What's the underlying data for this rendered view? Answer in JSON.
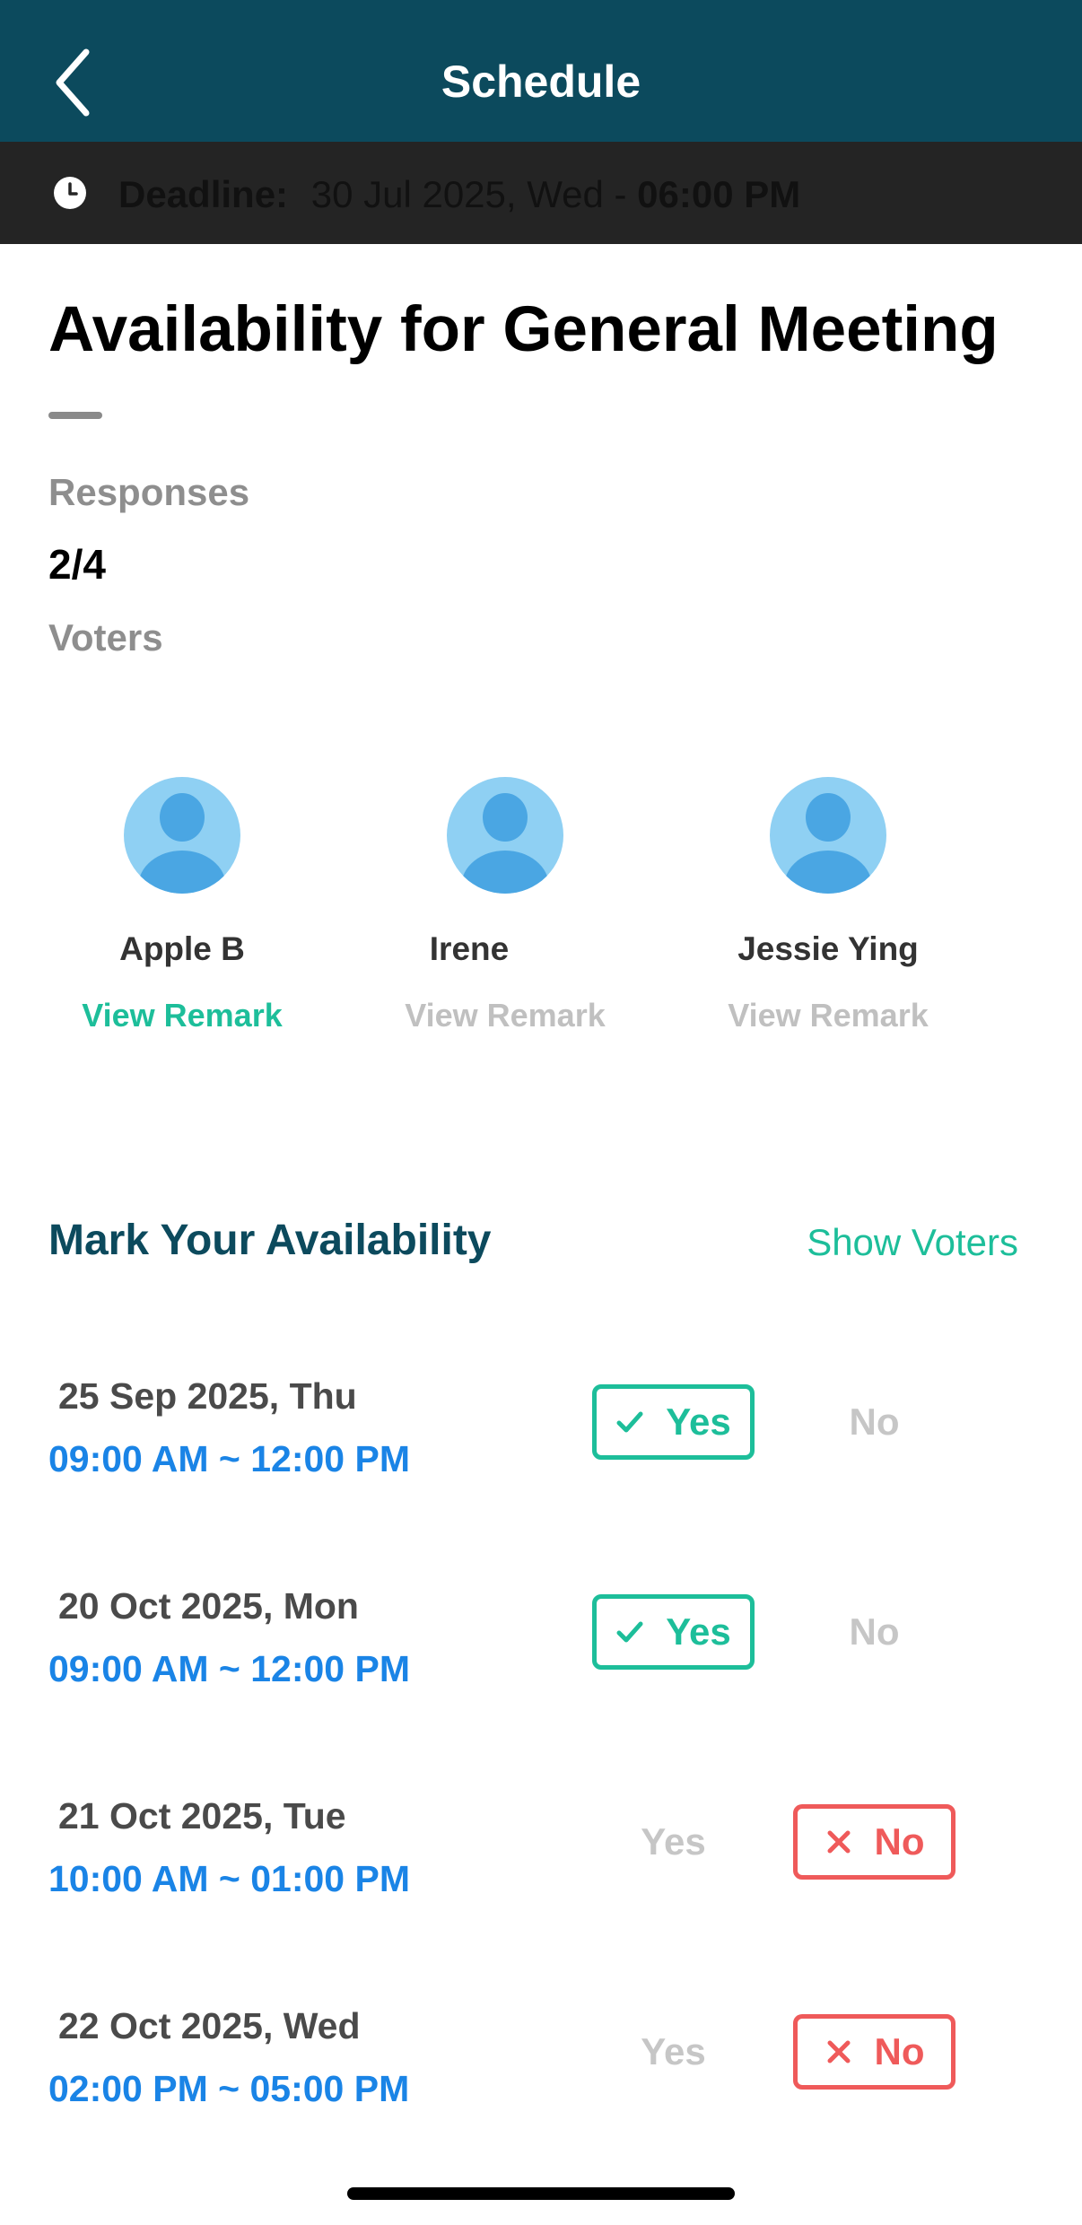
{
  "header": {
    "title": "Schedule"
  },
  "deadline": {
    "label": "Deadline:",
    "date": "30 Jul 2025, Wed -",
    "time": "06:00 PM"
  },
  "poll": {
    "title": "Availability for General Meeting",
    "responses_label": "Responses",
    "responses_value": "2/4",
    "voters_label": "Voters"
  },
  "voters": [
    {
      "name": "Apple B",
      "remark": "View Remark",
      "remark_active": true
    },
    {
      "name": "Irene",
      "remark": "View Remark",
      "remark_active": false
    },
    {
      "name": "Jessie Ying",
      "remark": "View Remark",
      "remark_active": false
    }
  ],
  "availability": {
    "title": "Mark Your Availability",
    "show_voters": "Show Voters",
    "yes_label": "Yes",
    "no_label": "No",
    "slots": [
      {
        "date": "25 Sep 2025, Thu",
        "time": "09:00 AM ~ 12:00 PM",
        "selected": "yes"
      },
      {
        "date": "20 Oct 2025, Mon",
        "time": "09:00 AM ~ 12:00 PM",
        "selected": "yes"
      },
      {
        "date": "21 Oct 2025, Tue",
        "time": "10:00 AM ~ 01:00 PM",
        "selected": "no"
      },
      {
        "date": "22 Oct 2025, Wed",
        "time": "02:00 PM ~ 05:00 PM",
        "selected": "no"
      }
    ]
  },
  "colors": {
    "header_bg": "#0c4a5d",
    "deadline_bg": "#242424",
    "accent_green": "#1dbe9a",
    "accent_red": "#ef5a5a",
    "time_blue": "#1a84e6"
  },
  "icons": {
    "back": "chevron-left-icon",
    "clock": "clock-icon",
    "avatar": "user-avatar-icon",
    "yes": "check-icon",
    "no": "x-icon"
  }
}
